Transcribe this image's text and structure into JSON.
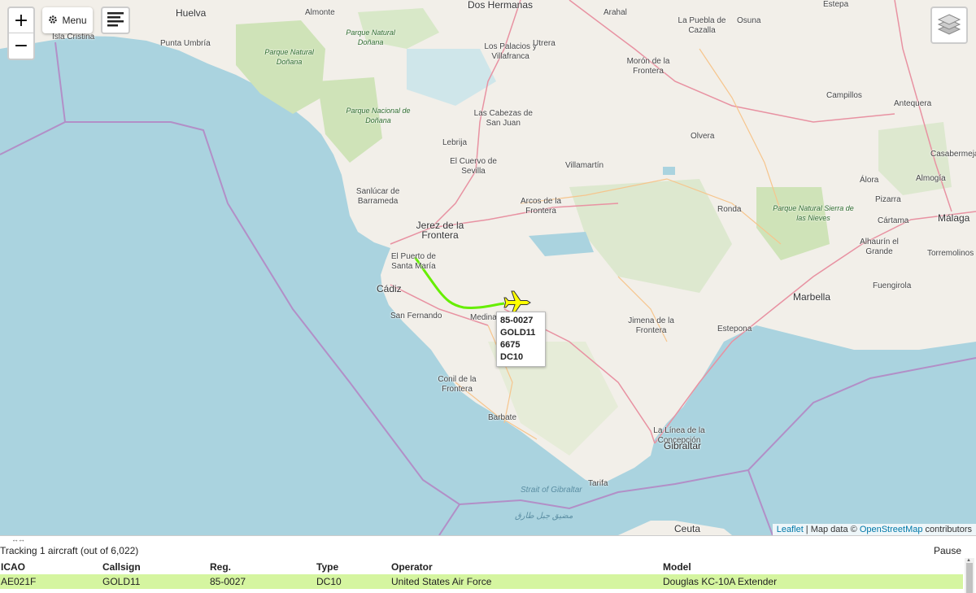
{
  "controls": {
    "zoom_in": "+",
    "zoom_out": "−",
    "menu_label": "Menu"
  },
  "places": [
    {
      "name": "Dos Hermanas",
      "cls": "big"
    },
    {
      "name": "Huelva",
      "cls": "big"
    },
    {
      "name": "Almonte",
      "cls": ""
    },
    {
      "name": "Arahal",
      "cls": ""
    },
    {
      "name": "La Puebla de Cazalla",
      "cls": ""
    },
    {
      "name": "Osuna",
      "cls": ""
    },
    {
      "name": "Estepa",
      "cls": ""
    },
    {
      "name": "Isla Cristina",
      "cls": ""
    },
    {
      "name": "Punta Umbría",
      "cls": ""
    },
    {
      "name": "Parque Natural Doñana",
      "cls": "park"
    },
    {
      "name": "Parque Natural Doñana",
      "cls": "park"
    },
    {
      "name": "Los Palacios y Villafranca",
      "cls": ""
    },
    {
      "name": "Utrera",
      "cls": ""
    },
    {
      "name": "Morón de la Frontera",
      "cls": ""
    },
    {
      "name": "Parque Nacional de Doñana",
      "cls": "park"
    },
    {
      "name": "Las Cabezas de San Juan",
      "cls": ""
    },
    {
      "name": "Campillos",
      "cls": ""
    },
    {
      "name": "Antequera",
      "cls": ""
    },
    {
      "name": "Lebrija",
      "cls": ""
    },
    {
      "name": "Olvera",
      "cls": ""
    },
    {
      "name": "El Cuervo de Sevilla",
      "cls": ""
    },
    {
      "name": "Casabermeja",
      "cls": ""
    },
    {
      "name": "Villamartín",
      "cls": ""
    },
    {
      "name": "Sanlúcar de Barrameda",
      "cls": ""
    },
    {
      "name": "Álora",
      "cls": ""
    },
    {
      "name": "Almogía",
      "cls": ""
    },
    {
      "name": "Arcos de la Frontera",
      "cls": ""
    },
    {
      "name": "Ronda",
      "cls": ""
    },
    {
      "name": "Pizarra",
      "cls": ""
    },
    {
      "name": "Jerez de la Frontera",
      "cls": "big"
    },
    {
      "name": "Parque Natural Sierra de las Nieves",
      "cls": "park"
    },
    {
      "name": "Cártama",
      "cls": ""
    },
    {
      "name": "Málaga",
      "cls": "big"
    },
    {
      "name": "El Puerto de Santa María",
      "cls": ""
    },
    {
      "name": "Alhaurín el Grande",
      "cls": ""
    },
    {
      "name": "Torremolinos",
      "cls": ""
    },
    {
      "name": "Cádiz",
      "cls": "big"
    },
    {
      "name": "Fuengirola",
      "cls": ""
    },
    {
      "name": "Marbella",
      "cls": "big"
    },
    {
      "name": "San Fernando",
      "cls": ""
    },
    {
      "name": "Medina",
      "cls": ""
    },
    {
      "name": "Jimena de la Frontera",
      "cls": ""
    },
    {
      "name": "Estepona",
      "cls": ""
    },
    {
      "name": "Conil de la Frontera",
      "cls": ""
    },
    {
      "name": "Barbate",
      "cls": ""
    },
    {
      "name": "La Línea de la Concepción",
      "cls": ""
    },
    {
      "name": "Gibraltar",
      "cls": "big"
    },
    {
      "name": "Strait of Gibraltar",
      "cls": "sea"
    },
    {
      "name": "مضيق جبل طارق",
      "cls": "sea"
    },
    {
      "name": "Tarifa",
      "cls": ""
    },
    {
      "name": "Ceuta",
      "cls": "big"
    }
  ],
  "aircraft_label": {
    "reg": "85-0027",
    "callsign": "GOLD11",
    "altitude": "6675",
    "type": "DC10"
  },
  "attribution": {
    "leaflet": "Leaflet",
    "sep": " | Map data © ",
    "osm": "OpenStreetMap",
    "suffix": " contributors"
  },
  "panel": {
    "handle": "↔↔",
    "tracking_text": "Tracking 1 aircraft (out of 6,022)",
    "pause_label": "Pause",
    "columns": [
      "ICAO",
      "Callsign",
      "Reg.",
      "Type",
      "Operator",
      "Model"
    ],
    "rows": [
      {
        "icao": "AE021F",
        "callsign": "GOLD11",
        "reg": "85-0027",
        "type": "DC10",
        "operator": "United States Air Force",
        "model": "Douglas KC-10A Extender"
      }
    ]
  },
  "colors": {
    "sea": "#aad3df",
    "land": "#f2efe9",
    "track": "#66ee00",
    "aircraft": "#ffff00",
    "selected_row": "#d5f5a0"
  }
}
